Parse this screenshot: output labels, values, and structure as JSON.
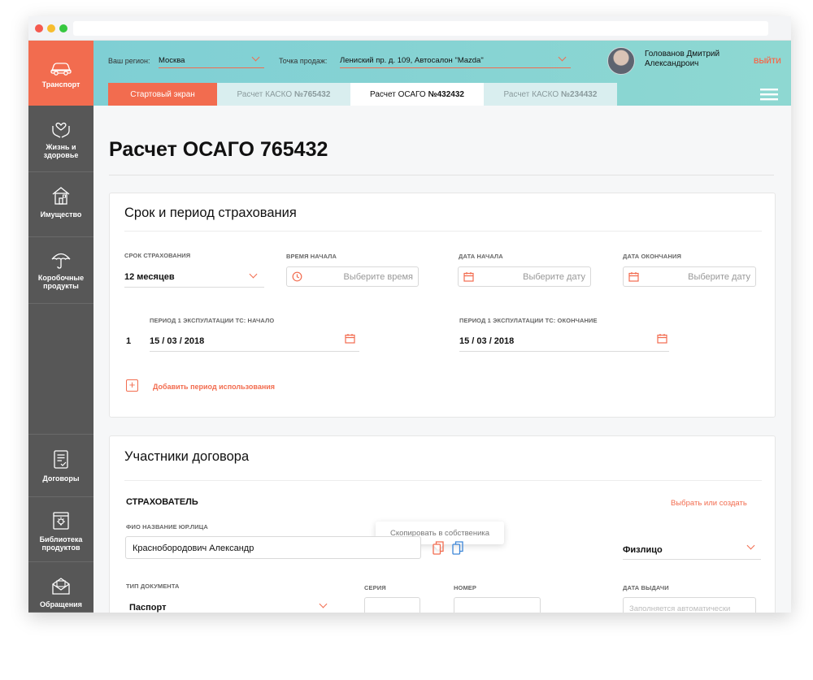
{
  "sidebar": {
    "items": [
      {
        "label": "Транспорт"
      },
      {
        "label": "Жизнь и здоровье"
      },
      {
        "label": "Имущество"
      },
      {
        "label": "Коробочные продукты"
      },
      {
        "label": "Договоры"
      },
      {
        "label": "Библиотека продуктов"
      },
      {
        "label": "Обращения"
      }
    ]
  },
  "header": {
    "region_label": "Ваш регион:",
    "region_value": "Москва",
    "point_label": "Точка продаж:",
    "point_value": "Лениский пр. д. 109, Автосалон \"Mazda\"",
    "user_name_line1": "Голованов Дмитрий",
    "user_name_line2": "Александроич",
    "logout": "ВЫЙТИ",
    "tabs": [
      {
        "label": "Стартовый экран",
        "number": ""
      },
      {
        "label": "Расчет КАСКО ",
        "number": "№765432"
      },
      {
        "label": "Расчет ОСАГО ",
        "number": "№432432"
      },
      {
        "label": "Расчет КАСКО ",
        "number": "№234432"
      }
    ]
  },
  "page": {
    "title": "Расчет ОСАГО 765432"
  },
  "term_card": {
    "title": "Срок и период страхования",
    "term_label": "СРОК СТРАХОВАНИЯ",
    "term_value": "12 месяцев",
    "start_time_label": "ВРЕМЯ НАЧАЛА",
    "start_time_placeholder": "Выберите время",
    "start_date_label": "ДАТА НАЧАЛА",
    "start_date_placeholder": "Выберите дату",
    "end_date_label": "ДАТА ОКОНЧАНИЯ",
    "end_date_placeholder": "Выберите дату",
    "period_start_label": "ПЕРИОД 1 ЭКСПУЛАТАЦИИ ТС: НАЧАЛО",
    "period_end_label": "ПЕРИОД 1 ЭКСПУЛАТАЦИИ ТС: ОКОНЧАНИЕ",
    "period_index": "1",
    "period_start_value": "15 / 03 / 2018",
    "period_end_value": "15 / 03 / 2018",
    "add_period": "Добавить период использования"
  },
  "participants_card": {
    "title": "Участники договора",
    "insurer_heading": "СТРАХОВАТЕЛЬ",
    "select_or_create": "Выбрать или создать",
    "name_label": "ФИО НАЗВАНИЕ ЮР.ЛИЦА",
    "name_value": "Красноборoдович Александр",
    "tooltip": "Скопировать в собственика",
    "person_type": "Физлицо",
    "doc_type_label": "ТИП ДОКУМЕНТА",
    "doc_type_value": "Паспорт",
    "series_label": "СЕРИЯ",
    "number_label": "НОМЕР",
    "issue_date_label": "ДАТА ВЫДАЧИ",
    "issue_date_placeholder": "Заполняется автоматически"
  },
  "colors": {
    "accent": "#f26c4f",
    "sidebar": "#575757",
    "header": "#86d3d3"
  }
}
